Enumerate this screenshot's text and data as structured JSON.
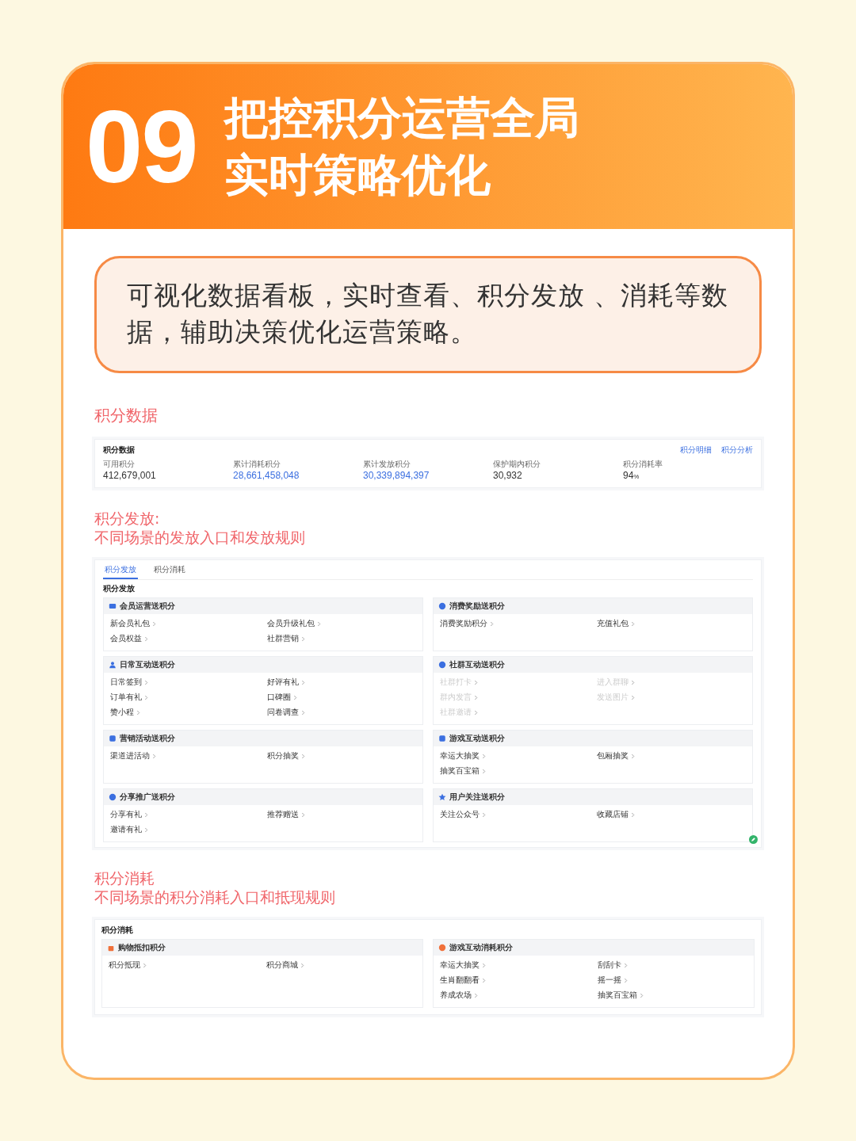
{
  "header": {
    "number": "09",
    "title_lines": [
      "把控积分运营全局",
      "实时策略优化"
    ]
  },
  "callout": "可视化数据看板，实时查看、积分发放 、消耗等数据，辅助决策优化运营策略。",
  "stats_section": {
    "label": "积分数据",
    "panel": {
      "title": "积分数据",
      "links": [
        "积分明细",
        "积分分析"
      ],
      "metrics": [
        {
          "label": "可用积分",
          "value": "412,679,001",
          "linked": false
        },
        {
          "label": "累计消耗积分",
          "value": "28,661,458,048",
          "linked": true
        },
        {
          "label": "累计发放积分",
          "value": "30,339,894,397",
          "linked": true
        },
        {
          "label": "保护期内积分",
          "value": "30,932",
          "linked": false
        },
        {
          "label": "积分消耗率",
          "value": "94",
          "unit": "%",
          "linked": false
        }
      ]
    }
  },
  "issue_section": {
    "label_lines": [
      "积分发放:",
      "不同场景的发放入口和发放规则"
    ],
    "panel": {
      "tabs": [
        {
          "label": "积分发放",
          "selected": true
        },
        {
          "label": "积分消耗",
          "selected": false
        }
      ],
      "title": "积分发放",
      "cards": [
        {
          "title": "会员运营送积分",
          "items": [
            {
              "label": "新会员礼包",
              "disabled": false
            },
            {
              "label": "会员升级礼包",
              "disabled": false
            },
            {
              "label": "会员权益",
              "disabled": false
            },
            {
              "label": "社群营销",
              "disabled": false
            }
          ]
        },
        {
          "title": "消费奖励送积分",
          "items": [
            {
              "label": "消费奖励积分",
              "disabled": false
            },
            {
              "label": "充值礼包",
              "disabled": false
            }
          ]
        },
        {
          "title": "日常互动送积分",
          "items": [
            {
              "label": "日常签到",
              "disabled": false
            },
            {
              "label": "好评有礼",
              "disabled": false
            },
            {
              "label": "订单有礼",
              "disabled": false
            },
            {
              "label": "口碑圈",
              "disabled": false
            },
            {
              "label": "赞小程",
              "disabled": false
            },
            {
              "label": "问卷调查",
              "disabled": false
            }
          ]
        },
        {
          "title": "社群互动送积分",
          "items": [
            {
              "label": "社群打卡",
              "disabled": true
            },
            {
              "label": "进入群聊",
              "disabled": true
            },
            {
              "label": "群内发言",
              "disabled": true
            },
            {
              "label": "发送图片",
              "disabled": true
            },
            {
              "label": "社群邀请",
              "disabled": true
            }
          ]
        },
        {
          "title": "营销活动送积分",
          "items": [
            {
              "label": "渠道进活动",
              "disabled": false
            },
            {
              "label": "积分抽奖",
              "disabled": false
            }
          ]
        },
        {
          "title": "游戏互动送积分",
          "items": [
            {
              "label": "幸运大抽奖",
              "disabled": false
            },
            {
              "label": "包厢抽奖",
              "disabled": false
            },
            {
              "label": "抽奖百宝箱",
              "disabled": false
            }
          ]
        },
        {
          "title": "分享推广送积分",
          "items": [
            {
              "label": "分享有礼",
              "disabled": false
            },
            {
              "label": "推荐赠送",
              "disabled": false
            },
            {
              "label": "邀请有礼",
              "disabled": false
            }
          ]
        },
        {
          "title": "用户关注送积分",
          "items": [
            {
              "label": "关注公众号",
              "disabled": false
            },
            {
              "label": "收藏店铺",
              "disabled": false
            }
          ]
        }
      ]
    }
  },
  "consume_section": {
    "label_lines": [
      "积分消耗",
      "不同场景的积分消耗入口和抵现规则"
    ],
    "panel": {
      "title": "积分消耗",
      "cards": [
        {
          "title": "购物抵扣积分",
          "items": [
            {
              "label": "积分抵现",
              "disabled": false
            },
            {
              "label": "积分商城",
              "disabled": false
            }
          ]
        },
        {
          "title": "游戏互动消耗积分",
          "items": [
            {
              "label": "幸运大抽奖",
              "disabled": false
            },
            {
              "label": "刮刮卡",
              "disabled": false
            },
            {
              "label": "生肖翻翻看",
              "disabled": false
            },
            {
              "label": "摇一摇",
              "disabled": false
            },
            {
              "label": "养成农场",
              "disabled": false
            },
            {
              "label": "抽奖百宝箱",
              "disabled": false
            }
          ]
        }
      ]
    }
  }
}
